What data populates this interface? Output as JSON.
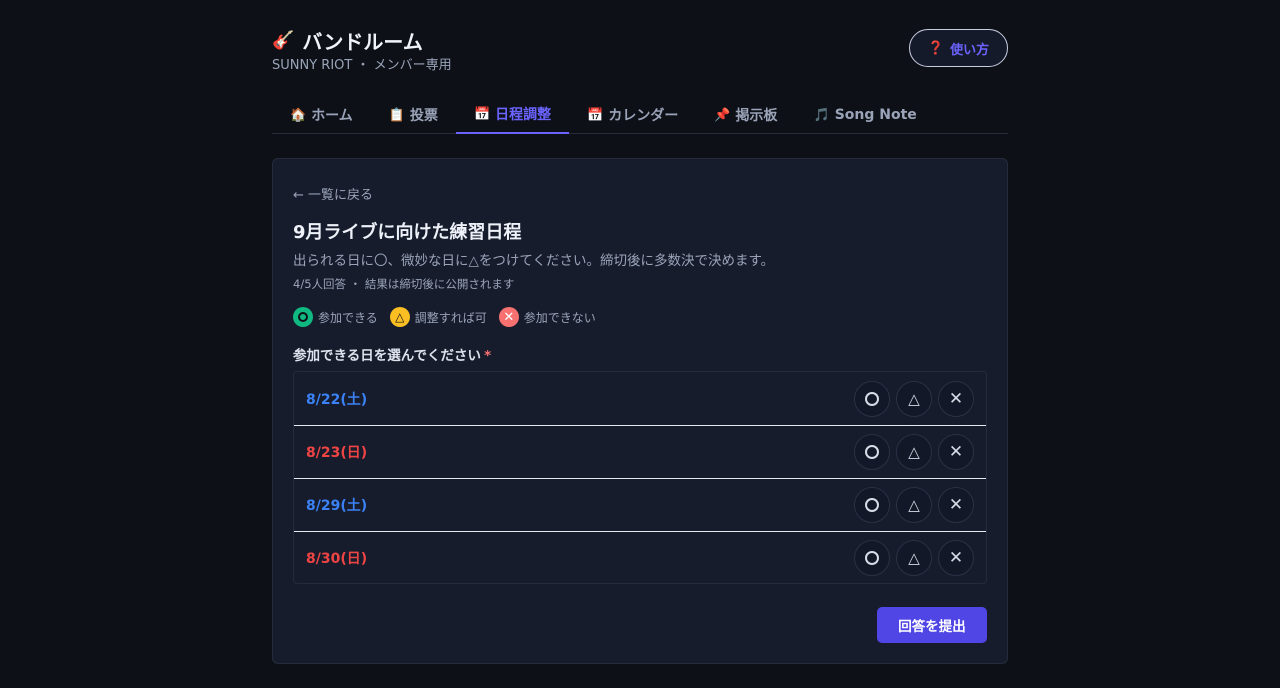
{
  "header": {
    "icon": "guitar-emoji",
    "title_emoji": "🎸",
    "title": "バンドルーム",
    "subtitle": "SUNNY RIOT ・ メンバー専用",
    "help_icon": "❓",
    "help_label": "使い方"
  },
  "tabs": [
    {
      "icon": "🏠",
      "label": "ホーム"
    },
    {
      "icon": "📋",
      "label": "投票"
    },
    {
      "icon": "📅",
      "label": "日程調整"
    },
    {
      "icon": "📅",
      "label": "カレンダー"
    },
    {
      "icon": "📌",
      "label": "掲示板"
    },
    {
      "icon": "🎵",
      "label": "Song Note"
    }
  ],
  "active_tab": "日程調整",
  "schedule": {
    "back_label": "← 一覧に戻る",
    "title": "9月ライブに向けた練習日程",
    "description": "出られる日に〇、微妙な日に△をつけてください。締切後に多数決で決めます。",
    "meta": "4/5人回答 ・ 結果は締切後に公開されます",
    "legend": {
      "ok": "参加できる",
      "maybe": "調整すれば可",
      "ng": "参加できない",
      "maybe_symbol": "△",
      "ng_symbol": "✕"
    },
    "section_label": "参加できる日を選んでください",
    "required_mark": "*",
    "dates": [
      {
        "label": "8/22(土)",
        "day": "sat"
      },
      {
        "label": "8/23(日)",
        "day": "sun"
      },
      {
        "label": "8/29(土)",
        "day": "sat"
      },
      {
        "label": "8/30(日)",
        "day": "sun"
      }
    ],
    "option_symbols": {
      "maybe": "△",
      "ng": "✕"
    },
    "submit_label": "回答を提出"
  },
  "colors": {
    "accent": "#5046e5",
    "saturday": "#3b82f6",
    "sunday": "#ef4444",
    "ok": "#10b981",
    "maybe": "#fbbf24",
    "ng": "#f87171"
  }
}
